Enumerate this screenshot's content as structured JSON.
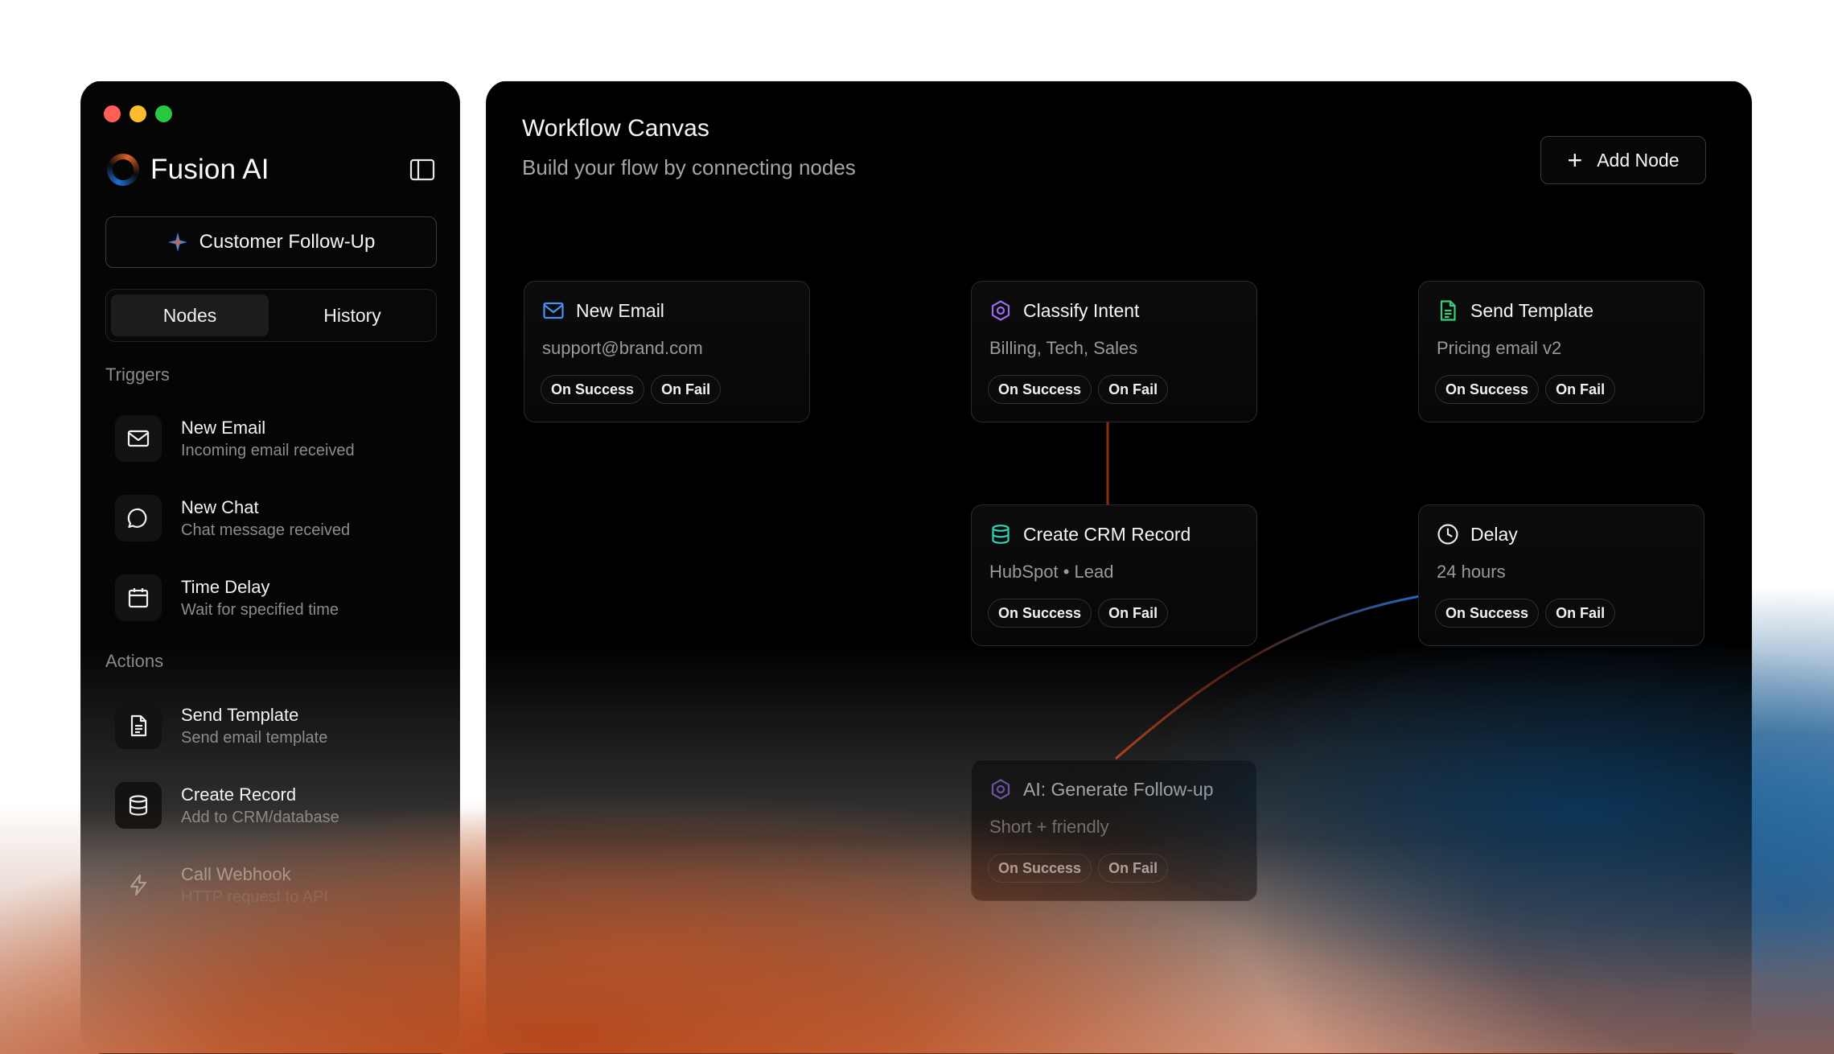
{
  "window": {
    "controls": [
      "close",
      "minimize",
      "zoom"
    ]
  },
  "sidebar": {
    "brand": "Fusion AI",
    "workflow": "Customer Follow-Up",
    "tabs": [
      {
        "label": "Nodes",
        "active": true
      },
      {
        "label": "History",
        "active": false
      }
    ],
    "triggers_label": "Triggers",
    "triggers": [
      {
        "title": "New Email",
        "subtitle": "Incoming email received",
        "icon": "mail-icon"
      },
      {
        "title": "New Chat",
        "subtitle": "Chat message received",
        "icon": "chat-icon"
      },
      {
        "title": "Time Delay",
        "subtitle": "Wait for specified time",
        "icon": "calendar-icon"
      }
    ],
    "actions_label": "Actions",
    "actions": [
      {
        "title": "Send Template",
        "subtitle": "Send email template",
        "icon": "document-icon"
      },
      {
        "title": "Create Record",
        "subtitle": "Add to CRM/database",
        "icon": "database-icon"
      },
      {
        "title": "Call Webhook",
        "subtitle": "HTTP request to API",
        "icon": "lightning-icon"
      }
    ]
  },
  "canvas": {
    "title": "Workflow Canvas",
    "subtitle": "Build your flow by connecting nodes",
    "add_node_label": "Add Node",
    "nodes": [
      {
        "title": "New Email",
        "subtitle": "support@brand.com",
        "icon": "mail-icon",
        "success": "On Success",
        "fail": "On Fail"
      },
      {
        "title": "Classify Intent",
        "subtitle": "Billing, Tech, Sales",
        "icon": "hexagon-icon",
        "success": "On Success",
        "fail": "On Fail"
      },
      {
        "title": "Send Template",
        "subtitle": "Pricing email v2",
        "icon": "document-icon",
        "success": "On Success",
        "fail": "On Fail"
      },
      {
        "title": "Create CRM Record",
        "subtitle": "HubSpot • Lead",
        "icon": "database-icon",
        "success": "On Success",
        "fail": "On Fail"
      },
      {
        "title": "Delay",
        "subtitle": "24 hours",
        "icon": "clock-icon",
        "success": "On Success",
        "fail": "On Fail"
      },
      {
        "title": "AI: Generate Follow-up",
        "subtitle": "Short + friendly",
        "icon": "hexagon-icon",
        "success": "On Success",
        "fail": "On Fail"
      }
    ]
  },
  "colors": {
    "wire_orange": "#c2461c",
    "wire_blue": "#1f6fd1",
    "mail_accent": "#4a90f0",
    "ai_accent": "#9b6cf2",
    "doc_accent": "#36d17a",
    "db_accent": "#2fd4b0"
  }
}
